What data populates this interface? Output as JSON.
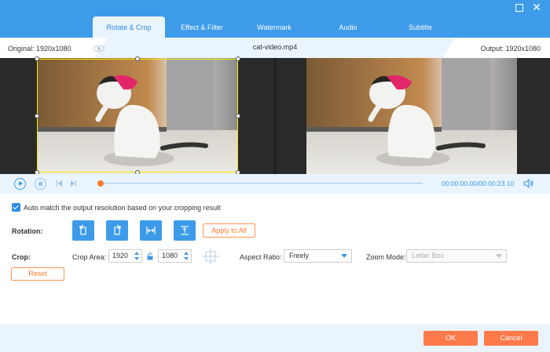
{
  "tabs": [
    {
      "label": "Rotate & Crop",
      "active": true
    },
    {
      "label": "Effect & Filter",
      "active": false
    },
    {
      "label": "Watermark",
      "active": false
    },
    {
      "label": "Audio",
      "active": false
    },
    {
      "label": "Subtitle",
      "active": false
    }
  ],
  "info": {
    "original": "Original: 1920x1080",
    "filename": "cat-video.mp4",
    "output": "Output: 1920x1080"
  },
  "playback": {
    "current_time": "00:00:00.00",
    "duration": "/00:00:23.10",
    "progress": 0.0
  },
  "settings": {
    "auto_match_label": "Auto match the output resolution based on your cropping result",
    "auto_match_checked": true,
    "rotation_label": "Rotation:",
    "apply_all_label": "Apply to All",
    "crop_label": "Crop:",
    "crop_area_label": "Crop Area:",
    "crop_width": "1920",
    "crop_height": "1080",
    "aspect_ratio_label": "Aspect Ratio:",
    "aspect_ratio_value": "Freely",
    "zoom_mode_label": "Zoom Mode:",
    "zoom_mode_value": "Letter Box",
    "reset_label": "Reset"
  },
  "footer": {
    "ok_label": "OK",
    "cancel_label": "Cancel"
  },
  "colors": {
    "accent": "#3d9be9",
    "orange": "#ff7a4a",
    "crop_border": "#f4ec00"
  }
}
